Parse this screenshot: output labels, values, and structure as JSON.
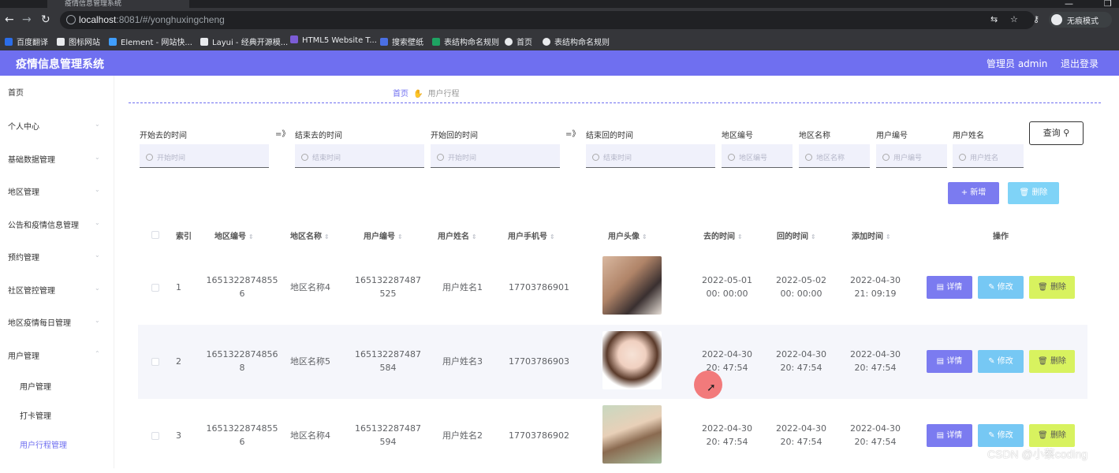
{
  "browser": {
    "tab_title": "疫情信息管理系统",
    "url_host": "localhost",
    "url_rest": ":8081/#/yonghuxingcheng",
    "incognito_label": "无痕模式",
    "bookmarks": [
      "百度翻译",
      "图标网站",
      "Element - 网站快...",
      "Layui - 经典开源模...",
      "HTML5 Website T...",
      "搜索壁纸",
      "表结构命名规则",
      "首页",
      "表结构命名规则"
    ]
  },
  "header": {
    "title": "疫情信息管理系统",
    "admin": "管理员 admin",
    "logout": "退出登录"
  },
  "sidebar": {
    "items": [
      "首页",
      "个人中心",
      "基础数据管理",
      "地区管理",
      "公告和疫情信息管理",
      "预约管理",
      "社区管控管理",
      "地区疫情每日管理",
      "用户管理"
    ],
    "sub_items": [
      "用户管理",
      "打卡管理",
      "用户行程管理"
    ]
  },
  "breadcrumb": {
    "home": "首页",
    "current": "用户行程"
  },
  "filters": {
    "labels": [
      "开始去的时间",
      "结束去的时间",
      "开始回的时间",
      "结束回的时间",
      "地区编号",
      "地区名称",
      "用户编号",
      "用户姓名"
    ],
    "arrow": "=》",
    "placeholders": [
      "开始时间",
      "结束时间",
      "开始时间",
      "结束时间",
      "地区编号",
      "地区名称",
      "用户编号",
      "用户姓名"
    ],
    "search_button": "查询"
  },
  "actions": {
    "add": "+ 新增",
    "delete": "删除"
  },
  "table": {
    "headers": [
      "索引",
      "地区编号",
      "地区名称",
      "用户编号",
      "用户姓名",
      "用户手机号",
      "用户头像",
      "去的时间",
      "回的时间",
      "添加时间",
      "操作"
    ],
    "rows": [
      {
        "index": "1",
        "region_code": "1651322874855 6",
        "region_name": "地区名称4",
        "user_code": "165132287487 525",
        "user_name": "用户姓名1",
        "phone": "17703786901",
        "go_time": "2022-05-01 00: 00:00",
        "back_time": "2022-05-02 00: 00:00",
        "add_time": "2022-04-30 21: 09:19"
      },
      {
        "index": "2",
        "region_code": "1651322874856 8",
        "region_name": "地区名称5",
        "user_code": "165132287487 584",
        "user_name": "用户姓名3",
        "phone": "17703786903",
        "go_time": "2022-04-30 20: 47:54",
        "back_time": "2022-04-30 20: 47:54",
        "add_time": "2022-04-30 20: 47:54"
      },
      {
        "index": "3",
        "region_code": "1651322874855 6",
        "region_name": "地区名称4",
        "user_code": "165132287487 594",
        "user_name": "用户姓名2",
        "phone": "17703786902",
        "go_time": "2022-04-30 20: 47:54",
        "back_time": "2022-04-30 20: 47:54",
        "add_time": "2022-04-30 20: 47:54"
      }
    ],
    "row_buttons": {
      "detail": "详情",
      "edit": "修改",
      "remove": "删除"
    }
  },
  "watermark": "CSDN @小蔡coding"
}
